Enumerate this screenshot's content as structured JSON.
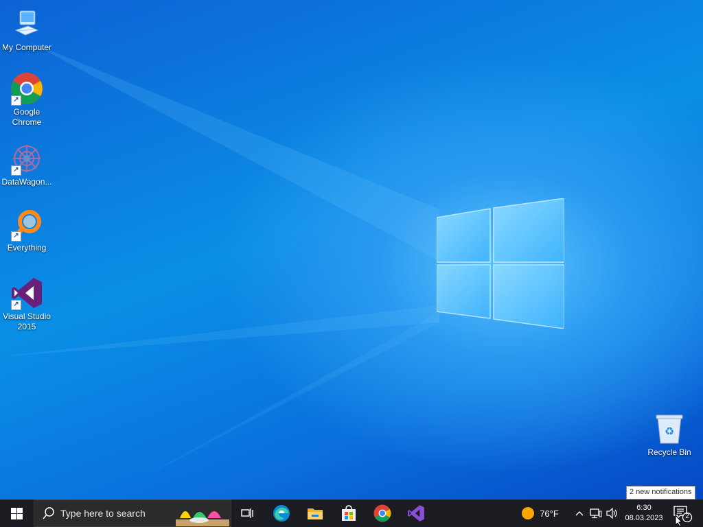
{
  "desktop": {
    "icons": [
      {
        "label": "My Computer",
        "icon": "my-computer-icon"
      },
      {
        "label": "Google Chrome",
        "icon": "chrome-icon"
      },
      {
        "label": "DataWagon...",
        "icon": "datawagon-icon"
      },
      {
        "label": "Everything",
        "icon": "everything-search-icon"
      },
      {
        "label": "Visual Studio 2015",
        "icon": "visual-studio-icon"
      },
      {
        "label": "Recycle Bin",
        "icon": "recycle-bin-icon"
      }
    ]
  },
  "taskbar": {
    "search_placeholder": "Type here to search",
    "pinned": [
      {
        "name": "task-view",
        "icon": "task-view-icon"
      },
      {
        "name": "edge",
        "icon": "edge-icon"
      },
      {
        "name": "file-explorer",
        "icon": "folder-icon"
      },
      {
        "name": "microsoft-store",
        "icon": "store-icon"
      },
      {
        "name": "chrome",
        "icon": "chrome-icon"
      },
      {
        "name": "visual-studio",
        "icon": "visual-studio-icon"
      }
    ],
    "weather": "76°F",
    "time": "6:30",
    "date": "08.03.2023",
    "notification_count": "2",
    "notification_tooltip": "2 new notifications"
  }
}
